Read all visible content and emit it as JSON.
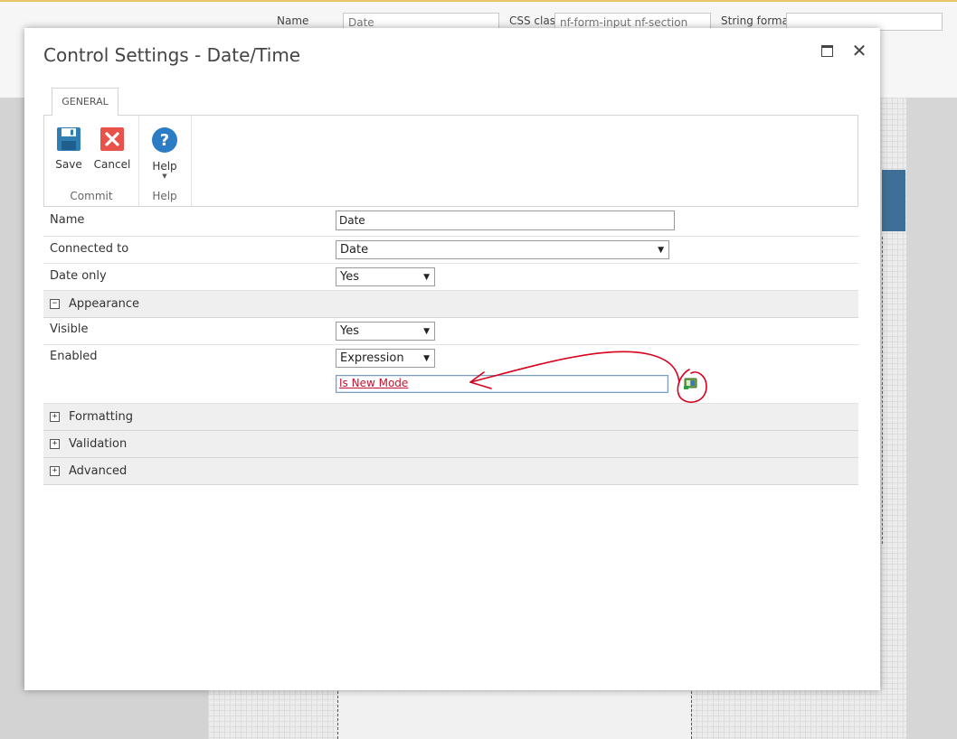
{
  "background": {
    "fields": [
      {
        "label": "Name",
        "value": "Date"
      },
      {
        "label": "CSS class",
        "value": "nf-form-input nf-section"
      },
      {
        "label": "String format",
        "value": ""
      }
    ]
  },
  "dialog": {
    "title": "Control Settings - Date/Time",
    "tab": "GENERAL",
    "ribbon": {
      "groups": [
        {
          "label": "Commit",
          "buttons": [
            {
              "label": "Save"
            },
            {
              "label": "Cancel"
            }
          ]
        },
        {
          "label": "Help",
          "buttons": [
            {
              "label": "Help"
            }
          ]
        }
      ]
    },
    "properties": {
      "name": {
        "label": "Name",
        "value": "Date"
      },
      "connected_to": {
        "label": "Connected to",
        "value": "Date"
      },
      "date_only": {
        "label": "Date only",
        "value": "Yes"
      },
      "appearance": {
        "label": "Appearance",
        "toggle": "−"
      },
      "visible": {
        "label": "Visible",
        "value": "Yes"
      },
      "enabled": {
        "label": "Enabled",
        "value": "Expression",
        "expression": "Is New Mode"
      },
      "formatting": {
        "label": "Formatting",
        "toggle": "+"
      },
      "validation": {
        "label": "Validation",
        "toggle": "+"
      },
      "advanced": {
        "label": "Advanced",
        "toggle": "+"
      }
    }
  },
  "colors": {
    "save_blue": "#2f7fb5",
    "cancel_red": "#e8524a",
    "help_blue": "#2b7cc4",
    "annotation_red": "#d8001c"
  }
}
